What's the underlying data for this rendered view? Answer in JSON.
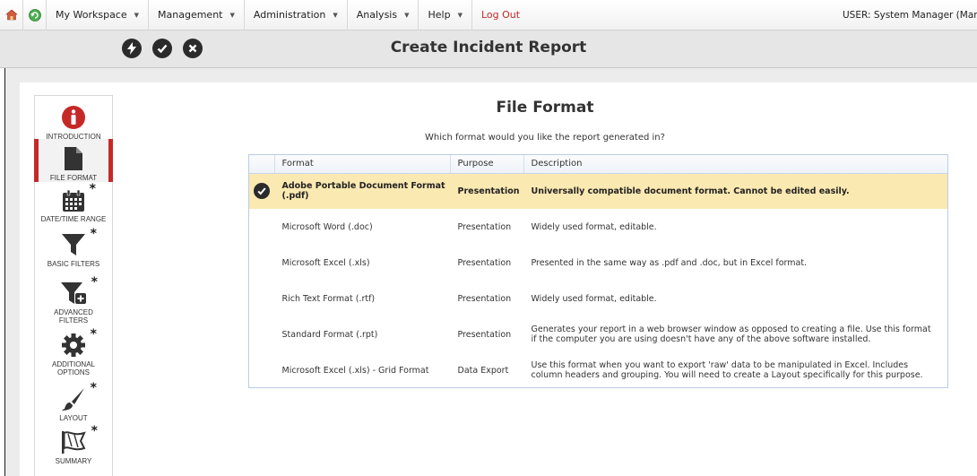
{
  "menubar": {
    "items": [
      {
        "label": "My Workspace",
        "has_caret": true
      },
      {
        "label": "Management",
        "has_caret": true
      },
      {
        "label": "Administration",
        "has_caret": true
      },
      {
        "label": "Analysis",
        "has_caret": true
      },
      {
        "label": "Help",
        "has_caret": true
      }
    ],
    "logout_label": "Log Out",
    "user_text": "USER: System Manager (Manager"
  },
  "titlebar": {
    "title": "Create Incident Report",
    "actions": [
      "lightning-icon",
      "check-icon",
      "close-icon"
    ]
  },
  "wizard": {
    "steps": [
      {
        "label": "INTRODUCTION",
        "icon": "info-icon",
        "required": false,
        "active": false
      },
      {
        "label": "FILE FORMAT",
        "icon": "file-icon",
        "required": false,
        "active": true
      },
      {
        "label": "DATE/TIME RANGE",
        "icon": "calendar-icon",
        "required": true,
        "active": false
      },
      {
        "label": "BASIC FILTERS",
        "icon": "filter-icon",
        "required": true,
        "active": false
      },
      {
        "label": "ADVANCED FILTERS",
        "icon": "advanced-filter-icon",
        "required": true,
        "active": false
      },
      {
        "label": "ADDITIONAL OPTIONS",
        "icon": "gear-icon",
        "required": true,
        "active": false
      },
      {
        "label": "LAYOUT",
        "icon": "brush-icon",
        "required": true,
        "active": false
      },
      {
        "label": "SUMMARY",
        "icon": "flag-icon",
        "required": true,
        "active": false
      }
    ],
    "required_marker": "*"
  },
  "content": {
    "title": "File Format",
    "subtitle": "Which format would you like the report generated in?",
    "columns": [
      "Format",
      "Purpose",
      "Description"
    ],
    "rows": [
      {
        "format": "Adobe Portable Document Format (.pdf)",
        "purpose": "Presentation",
        "description": "Universally compatible document format. Cannot be edited easily.",
        "selected": true
      },
      {
        "format": "Microsoft Word (.doc)",
        "purpose": "Presentation",
        "description": "Widely used format, editable.",
        "selected": false
      },
      {
        "format": "Microsoft Excel (.xls)",
        "purpose": "Presentation",
        "description": "Presented in the same way as .pdf and .doc, but in Excel format.",
        "selected": false
      },
      {
        "format": "Rich Text Format (.rtf)",
        "purpose": "Presentation",
        "description": "Widely used format, editable.",
        "selected": false
      },
      {
        "format": "Standard Format (.rpt)",
        "purpose": "Presentation",
        "description": "Generates your report in a web browser window as opposed to creating a file. Use this format if the computer you are using doesn't have any of the above software installed.",
        "selected": false
      },
      {
        "format": "Microsoft Excel (.xls) - Grid Format",
        "purpose": "Data Export",
        "description": "Use this format when you want to export 'raw' data to be manipulated in Excel. Includes column headers and grouping. You will need to create a Layout specifically for this purpose.",
        "selected": false
      }
    ]
  },
  "colors": {
    "accent_red": "#c62828",
    "selected_row": "#fbe9b2",
    "grid_border": "#b9cde4"
  }
}
